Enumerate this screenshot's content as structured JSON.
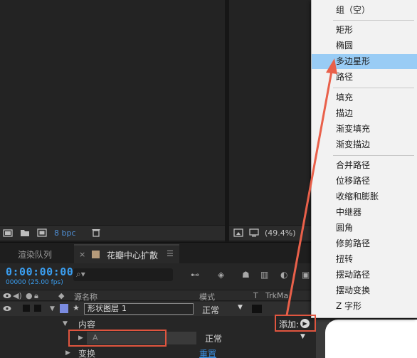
{
  "project_panel": {
    "bpc_label": "8 bpc",
    "icons": [
      "interpret-footage-icon",
      "new-folder-icon",
      "new-composition-icon",
      "trash-icon"
    ]
  },
  "viewer": {
    "zoom_label": "(49.4%)",
    "icons": [
      "snapshot-icon",
      "monitor-icon"
    ]
  },
  "timeline": {
    "tab_render_queue": "渲染队列",
    "tab_active_close": "×",
    "tab_active_label": "花瓣中心扩散",
    "tab_menu": "☰",
    "timecode": "0:00:00:00",
    "fps": "00000 (25.00 fps)",
    "search_icon": "search-icon",
    "columns": {
      "source_name": "源名称",
      "mode": "模式",
      "t": "T",
      "trkmat": "TrkMa"
    },
    "layer": {
      "color": "#7a8be0",
      "name": "形状图层",
      "number": "1",
      "mode": "正常"
    },
    "content_row": {
      "label": "内容",
      "add_label": "添加:"
    },
    "shape_row": {
      "name": "A",
      "mode": "正常"
    },
    "transform_row": {
      "label": "变换",
      "reset": "重置"
    }
  },
  "add_menu": {
    "items": [
      "组（空）",
      "矩形",
      "椭圆",
      "多边星形",
      "路径",
      "填充",
      "描边",
      "渐变填充",
      "渐变描边",
      "合并路径",
      "位移路径",
      "收缩和膨胀",
      "中继器",
      "圆角",
      "修剪路径",
      "扭转",
      "摆动路径",
      "摆动变换",
      "Z 字形"
    ],
    "highlighted": "多边星形"
  },
  "colors": {
    "accent_blue": "#3a9ef0",
    "annotation_red": "#e0553f",
    "menu_highlight": "#99ccf5"
  }
}
